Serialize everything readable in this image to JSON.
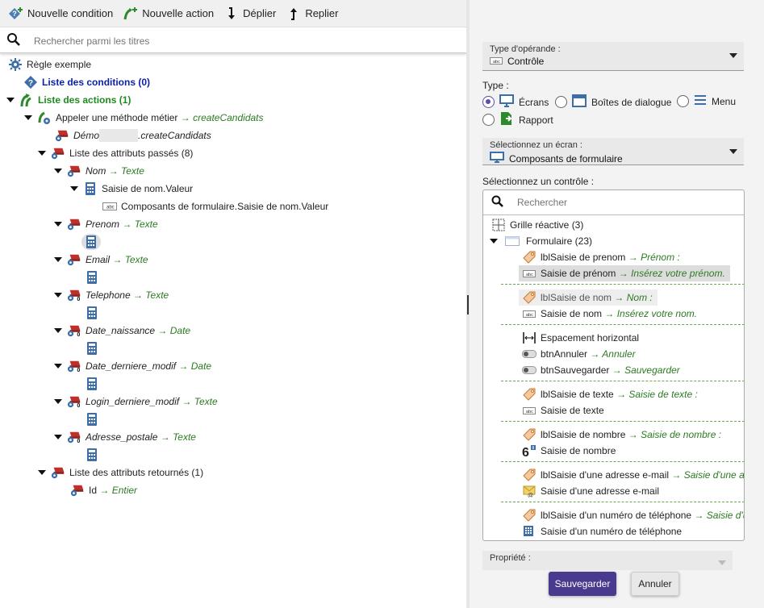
{
  "toolbar": {
    "new_condition": "Nouvelle condition",
    "new_action": "Nouvelle action",
    "expand": "Déplier",
    "collapse": "Replier"
  },
  "search": {
    "placeholder": "Rechercher parmi les titres"
  },
  "tree": {
    "rule": "Règle exemple",
    "conditions": "Liste des conditions (0)",
    "actions": "Liste des actions (1)",
    "method_call": "Appeler une méthode métier",
    "method_name": "→ createCandidats",
    "demo_prefix": "Démo",
    "demo_suffix": ".createCandidats",
    "passed_attrs": "Liste des attributs passés (8)",
    "attributes": [
      {
        "name": "Nom",
        "type": "→ Texte"
      },
      {
        "name": "Prenom",
        "type": "→ Texte"
      },
      {
        "name": "Email",
        "type": "→ Texte"
      },
      {
        "name": "Telephone",
        "type": "→ Texte"
      },
      {
        "name": "Date_naissance",
        "type": "→ Date"
      },
      {
        "name": "Date_derniere_modif",
        "type": "→ Date"
      },
      {
        "name": "Login_derniere_modif",
        "type": "→ Texte"
      },
      {
        "name": "Adresse_postale",
        "type": "→ Texte"
      }
    ],
    "nom_value": "Saisie de nom.Valeur",
    "nom_value_full": "Composants de formulaire.Saisie de nom.Valeur",
    "returned_attrs": "Liste des attributs retournés (1)",
    "returned": {
      "name": "Id",
      "type": "→ Entier"
    }
  },
  "panel": {
    "operand_label": "Type d'opérande :",
    "operand_value": "Contrôle",
    "type_label": "Type :",
    "types": [
      "Écrans",
      "Boîtes de dialogue",
      "Menu",
      "Rapport"
    ],
    "screen_label": "Sélectionnez un écran :",
    "screen_value": "Composants de formulaire",
    "control_label": "Sélectionnez un contrôle :",
    "control_search_placeholder": "Rechercher",
    "grid": "Grille réactive (3)",
    "form": "Formulaire (23)",
    "items": [
      {
        "text": "lblSaisie de prenom",
        "arrow": "→ Prénom :"
      },
      {
        "text": "Saisie de prénom",
        "arrow": "→ Insérez votre prénom."
      },
      {
        "text": "lblSaisie de nom",
        "arrow": "→ Nom :"
      },
      {
        "text": "Saisie de nom",
        "arrow": "→ Insérez votre nom."
      },
      {
        "text": "Espacement horizontal",
        "arrow": ""
      },
      {
        "text": "btnAnnuler",
        "arrow": "→ Annuler"
      },
      {
        "text": "btnSauvegarder",
        "arrow": "→ Sauvegarder"
      },
      {
        "text": "lblSaisie de texte",
        "arrow": "→ Saisie de texte :"
      },
      {
        "text": "Saisie de texte",
        "arrow": ""
      },
      {
        "text": "lblSaisie de nombre",
        "arrow": "→ Saisie de nombre :"
      },
      {
        "text": "Saisie de nombre",
        "arrow": ""
      },
      {
        "text": "lblSaisie d'une adresse e-mail",
        "arrow": "→ Saisie d'une ac"
      },
      {
        "text": "Saisie d'une adresse e-mail",
        "arrow": ""
      },
      {
        "text": "lblSaisie d'un numéro de téléphone",
        "arrow": "→ Saisie d'u"
      },
      {
        "text": "Saisie d'un numéro de téléphone",
        "arrow": ""
      }
    ],
    "property_label": "Propriété :",
    "save": "Sauvegarder",
    "cancel": "Annuler"
  },
  "colors": {
    "accent": "#5b4ea8",
    "button": "#4a3a8e",
    "green_text": "#2c7a22",
    "blue_text": "#0b1fa8"
  }
}
